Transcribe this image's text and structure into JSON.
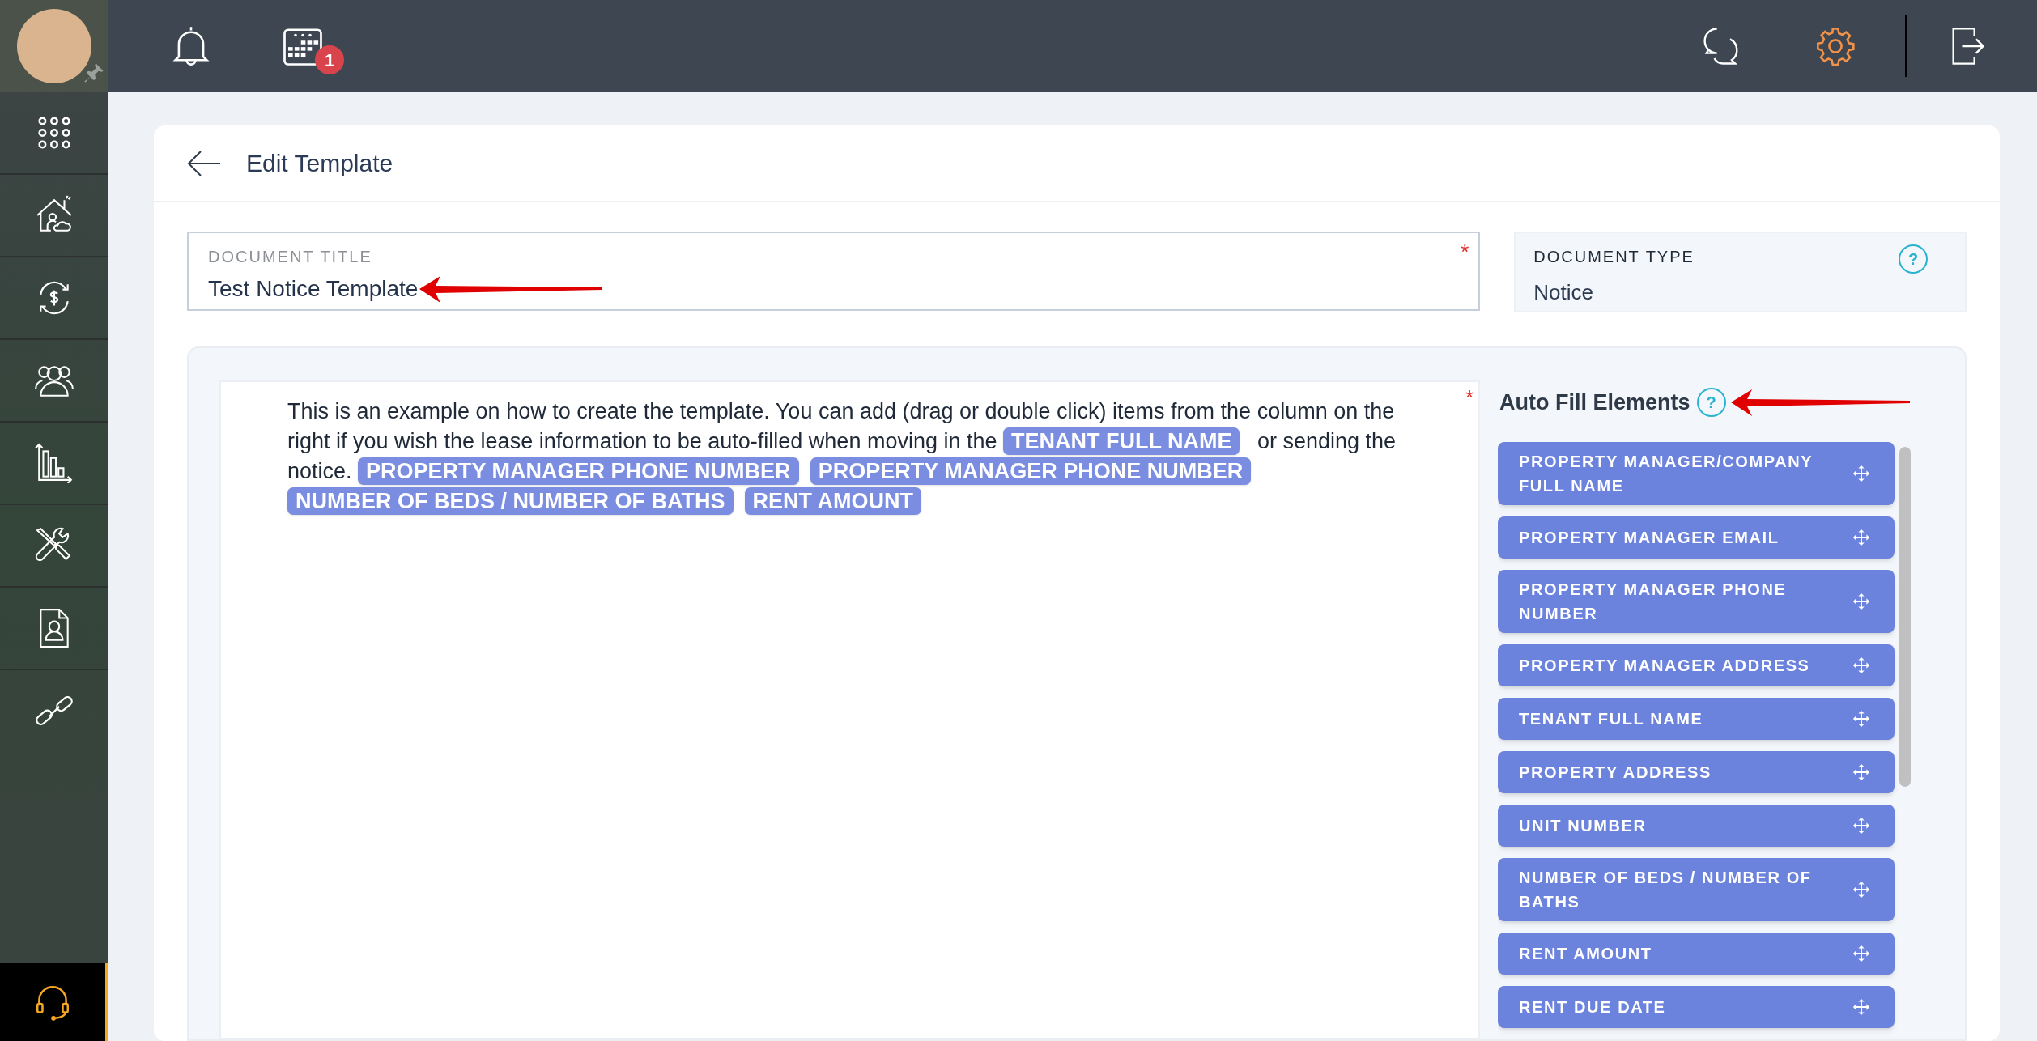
{
  "topbar": {
    "calendar_badge": "1"
  },
  "page": {
    "title": "Edit Template"
  },
  "document_title": {
    "label": "DOCUMENT TITLE",
    "value": "Test Notice Template",
    "required_mark": "*"
  },
  "document_type": {
    "label": "DOCUMENT TYPE",
    "value": "Notice",
    "help": "?"
  },
  "editor": {
    "required_mark": "*",
    "content": [
      {
        "kind": "text",
        "text": "This is an example on how to create the template. You can add (drag or double click) items from the column on the right if you wish the lease information to be auto-filled when moving in the "
      },
      {
        "kind": "chip",
        "text": "TENANT FULL NAME"
      },
      {
        "kind": "text",
        "text": " or sending the notice. "
      },
      {
        "kind": "chip",
        "text": "PROPERTY MANAGER PHONE NUMBER"
      },
      {
        "kind": "chip",
        "text": "PROPERTY MANAGER PHONE NUMBER"
      },
      {
        "kind": "chip",
        "text": "NUMBER OF BEDS / NUMBER OF BATHS"
      },
      {
        "kind": "chip",
        "text": "RENT AMOUNT"
      }
    ]
  },
  "auto_fill": {
    "title": "Auto Fill Elements",
    "help": "?",
    "items": [
      {
        "label": "PROPERTY MANAGER/COMPANY FULL NAME"
      },
      {
        "label": "PROPERTY MANAGER EMAIL"
      },
      {
        "label": "PROPERTY MANAGER PHONE NUMBER"
      },
      {
        "label": "PROPERTY MANAGER ADDRESS"
      },
      {
        "label": "TENANT FULL NAME"
      },
      {
        "label": "PROPERTY ADDRESS"
      },
      {
        "label": "UNIT NUMBER"
      },
      {
        "label": "NUMBER OF BEDS / NUMBER OF BATHS"
      },
      {
        "label": "RENT AMOUNT"
      },
      {
        "label": "RENT DUE DATE"
      }
    ]
  }
}
